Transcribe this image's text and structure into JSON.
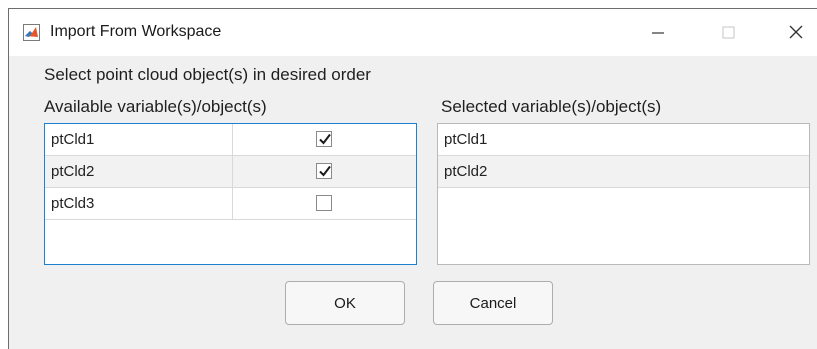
{
  "window": {
    "title": "Import From Workspace"
  },
  "instruction": "Select point cloud object(s) in desired order",
  "available": {
    "label": "Available variable(s)/object(s)",
    "rows": [
      {
        "name": "ptCld1",
        "checked": true
      },
      {
        "name": "ptCld2",
        "checked": true
      },
      {
        "name": "ptCld3",
        "checked": false
      }
    ]
  },
  "selected": {
    "label": "Selected variable(s)/object(s)",
    "rows": [
      "ptCld1",
      "ptCld2"
    ]
  },
  "buttons": {
    "ok": "OK",
    "cancel": "Cancel"
  },
  "colors": {
    "focus_border": "#1f7fd1",
    "dialog_bg": "#f0f0f0"
  }
}
